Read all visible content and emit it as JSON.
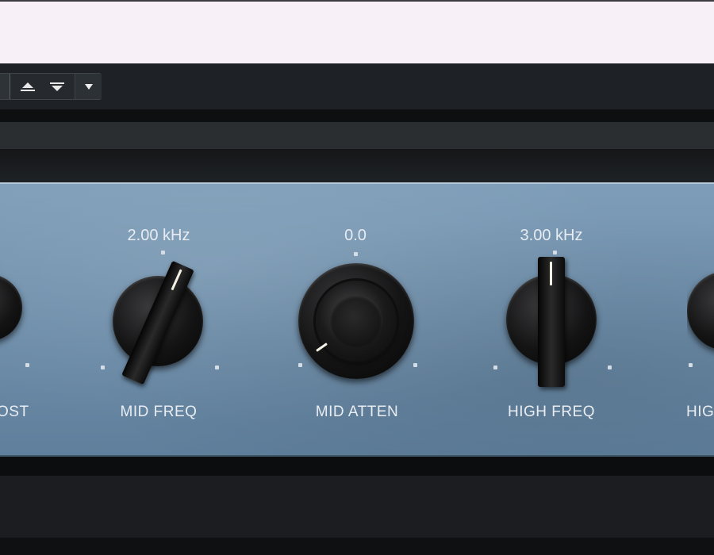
{
  "toolbar": {
    "buttons": {
      "up": "up-arrow-icon",
      "down": "down-arrow-icon",
      "menu": "dropdown-icon"
    }
  },
  "plugin": {
    "panel_color": "#6f8fab",
    "knobs": [
      {
        "id": "boost",
        "value": "",
        "label": "OST"
      },
      {
        "id": "mid-freq",
        "value": "2.00 kHz",
        "label": "MID FREQ"
      },
      {
        "id": "mid-atten",
        "value": "0.0",
        "label": "MID ATTEN"
      },
      {
        "id": "high-freq",
        "value": "3.00 kHz",
        "label": "HIGH FREQ"
      },
      {
        "id": "high-partial",
        "value": "",
        "label": "HIG"
      }
    ]
  }
}
